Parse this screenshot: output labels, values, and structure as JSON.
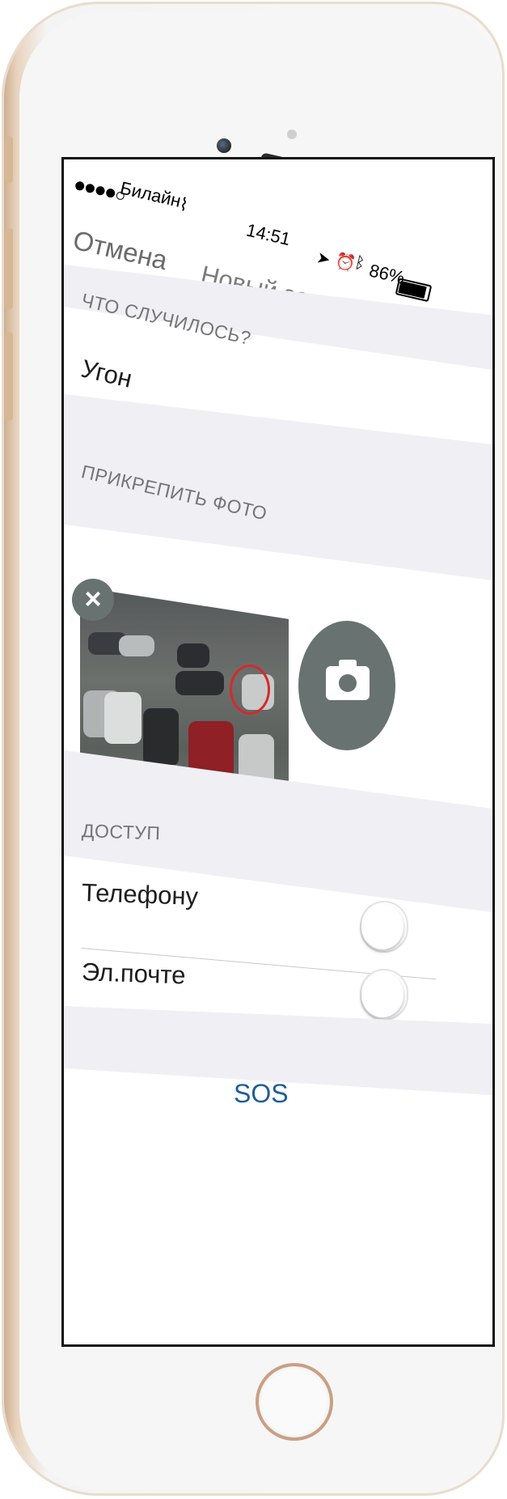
{
  "status_bar": {
    "carrier": "Билайн",
    "time": "14:51",
    "battery": "86%",
    "signal_bars_filled": 4,
    "signal_bars_total": 5,
    "battery_level": 0.86
  },
  "nav": {
    "cancel_label": "Отмена",
    "title": "Новый запрос"
  },
  "sections": {
    "what_happened": {
      "header": "ЧТО СЛУЧИЛОСЬ?",
      "value": "Угон"
    },
    "attach_photo": {
      "header": "ПРИКРЕПИТЬ ФОТО",
      "remove_icon": "close-icon",
      "camera_icon": "camera-icon"
    },
    "access": {
      "header": "ДОСТУП",
      "options": [
        {
          "label": "Телефону",
          "enabled": false
        },
        {
          "label": "Эл.почте",
          "enabled": false
        }
      ]
    }
  },
  "sos_label": "SOS",
  "colors": {
    "background_grouped": "#efeff4",
    "accent": "#1f5d98",
    "button_gray": "#687271",
    "photo_marker": "#d42a2a",
    "phone_gold": "#d6b897"
  }
}
